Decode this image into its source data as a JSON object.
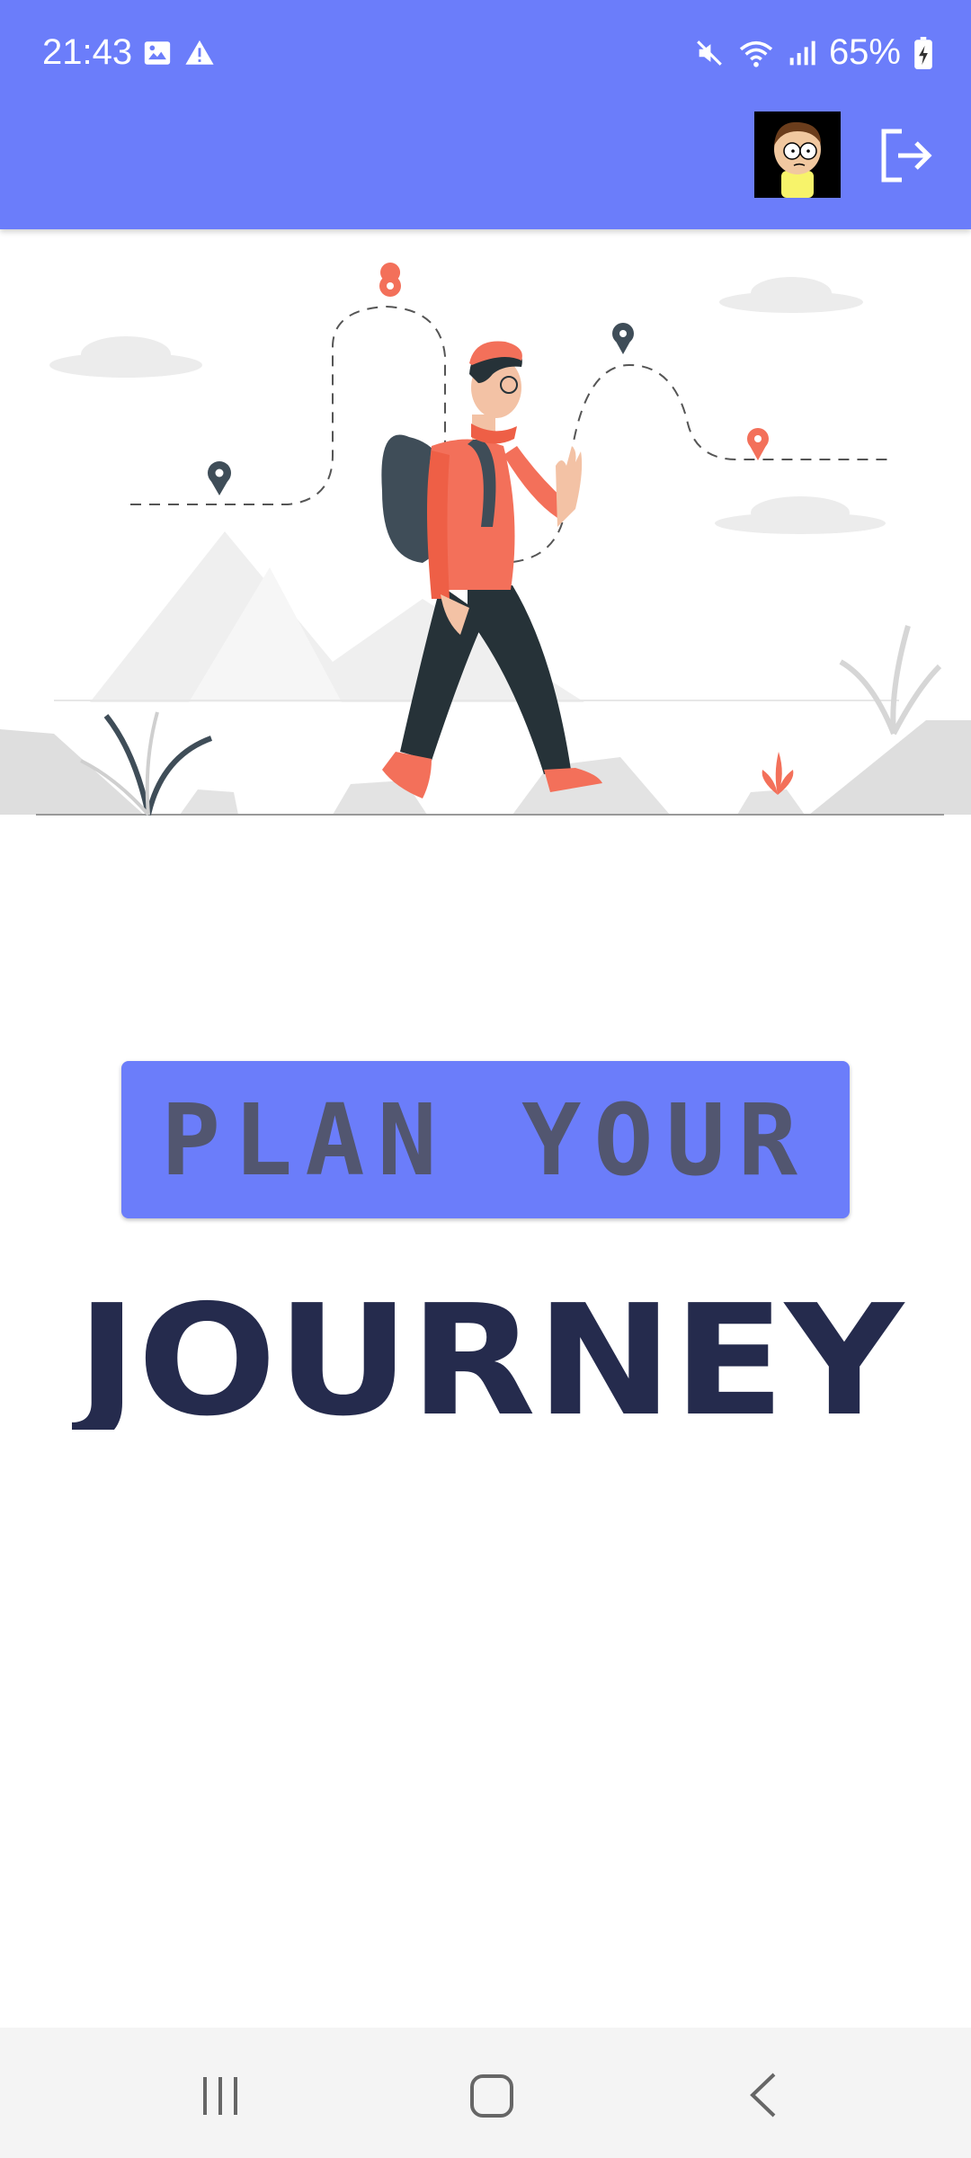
{
  "status_bar": {
    "time": "21:43",
    "battery": "65%",
    "icons": [
      "image-icon",
      "warning-icon",
      "mute-icon",
      "wifi-icon",
      "signal-icon",
      "battery-icon"
    ]
  },
  "app_bar": {
    "color": "#6b7dfa",
    "avatar_icon": "avatar-cartoon",
    "logout_icon": "logout-icon"
  },
  "hero": {
    "illustration": "hiker-walking-illustration"
  },
  "banner": {
    "text": "PLAN YOUR",
    "background": "#6b7dfa",
    "text_color": "#525670"
  },
  "journey": {
    "text": "JOURNEY",
    "color": "#252b4d"
  },
  "nav": {
    "icons": [
      "recents-icon",
      "home-icon",
      "back-icon"
    ]
  }
}
